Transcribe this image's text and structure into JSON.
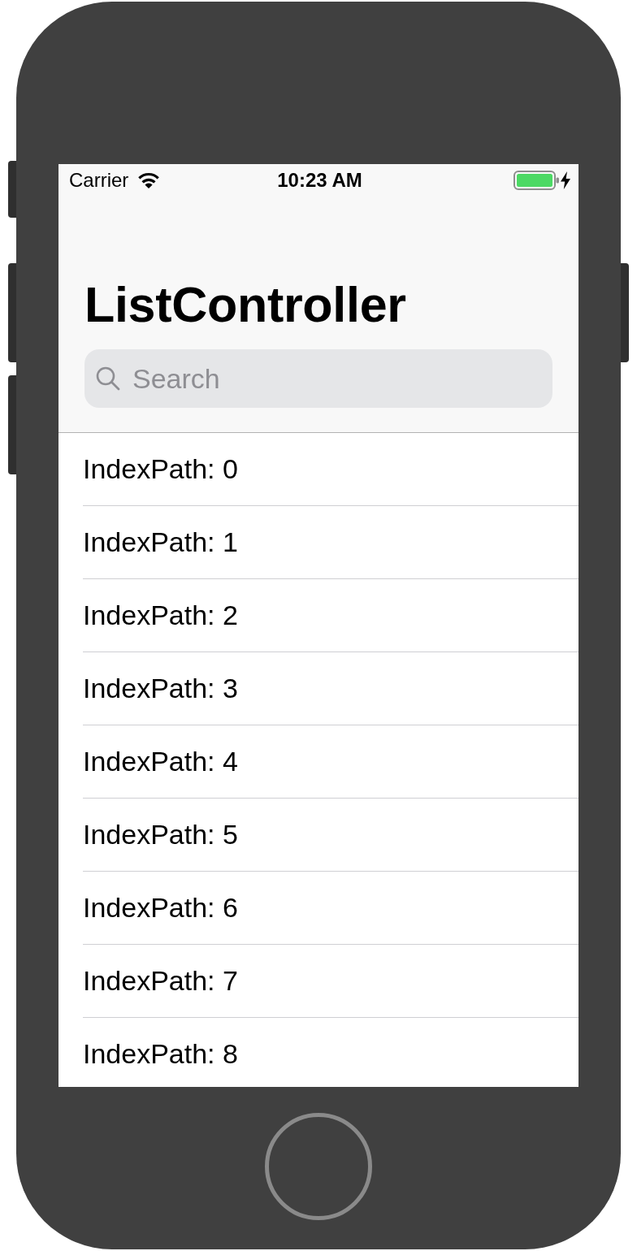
{
  "status_bar": {
    "carrier": "Carrier",
    "time": "10:23 AM",
    "charging": true
  },
  "navigation_bar": {
    "title": "ListController",
    "search": {
      "placeholder": "Search"
    }
  },
  "list": {
    "rows": [
      {
        "label": "IndexPath: 0"
      },
      {
        "label": "IndexPath: 1"
      },
      {
        "label": "IndexPath: 2"
      },
      {
        "label": "IndexPath: 3"
      },
      {
        "label": "IndexPath: 4"
      },
      {
        "label": "IndexPath: 5"
      },
      {
        "label": "IndexPath: 6"
      },
      {
        "label": "IndexPath: 7"
      },
      {
        "label": "IndexPath: 8"
      }
    ]
  }
}
